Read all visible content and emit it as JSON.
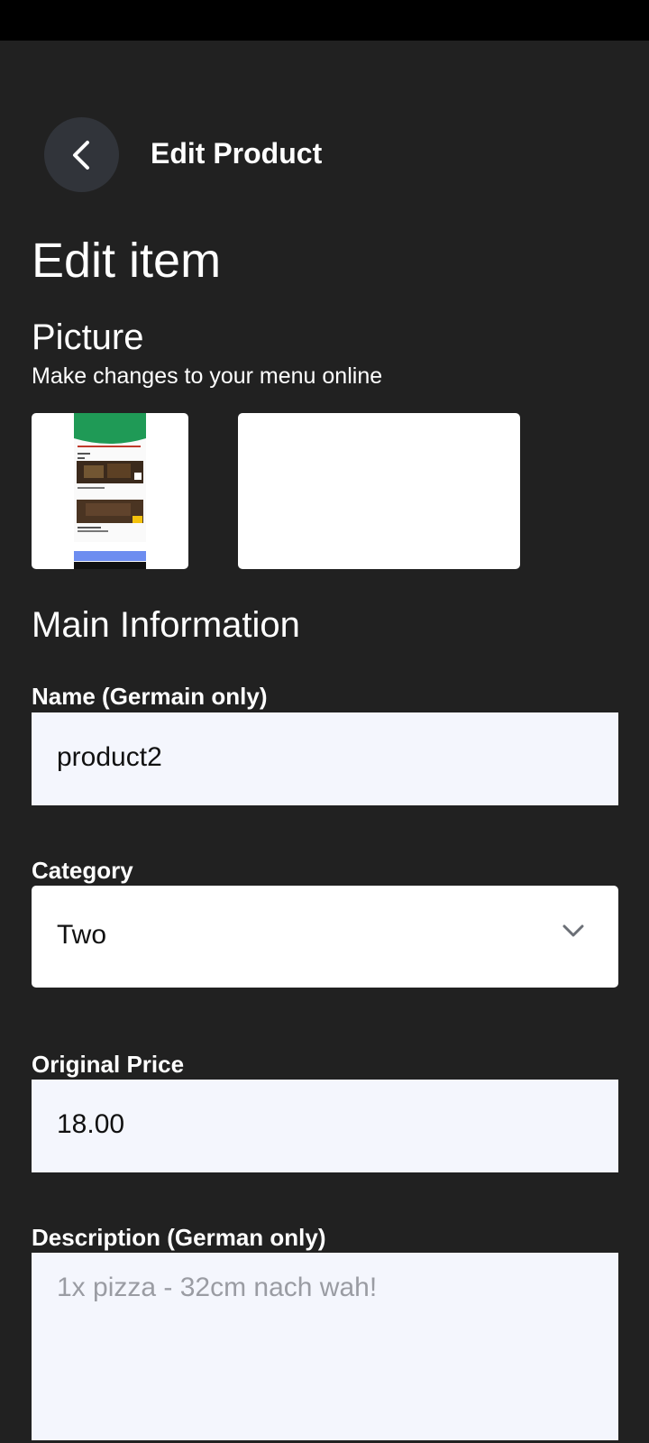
{
  "app_bar": {
    "title": "Edit Product",
    "back_icon": "chevron-left-icon"
  },
  "page": {
    "heading": "Edit item"
  },
  "picture_section": {
    "heading": "Picture",
    "subtitle": "Make changes to your menu online"
  },
  "main_info": {
    "heading": "Main Information"
  },
  "fields": {
    "name": {
      "label": "Name (Germain only)",
      "value": "product2"
    },
    "category": {
      "label": "Category",
      "value": "Two",
      "icon": "chevron-down-icon"
    },
    "price": {
      "label": "Original Price",
      "value": "18.00"
    },
    "description": {
      "label": "Description (German only)",
      "placeholder": "1x pizza - 32cm nach wah!"
    }
  },
  "colors": {
    "background": "#212121",
    "status_bar": "#000000",
    "back_button_bg": "#31343a",
    "field_bg": "#f4f6fd",
    "placeholder": "#9a9ca3"
  }
}
